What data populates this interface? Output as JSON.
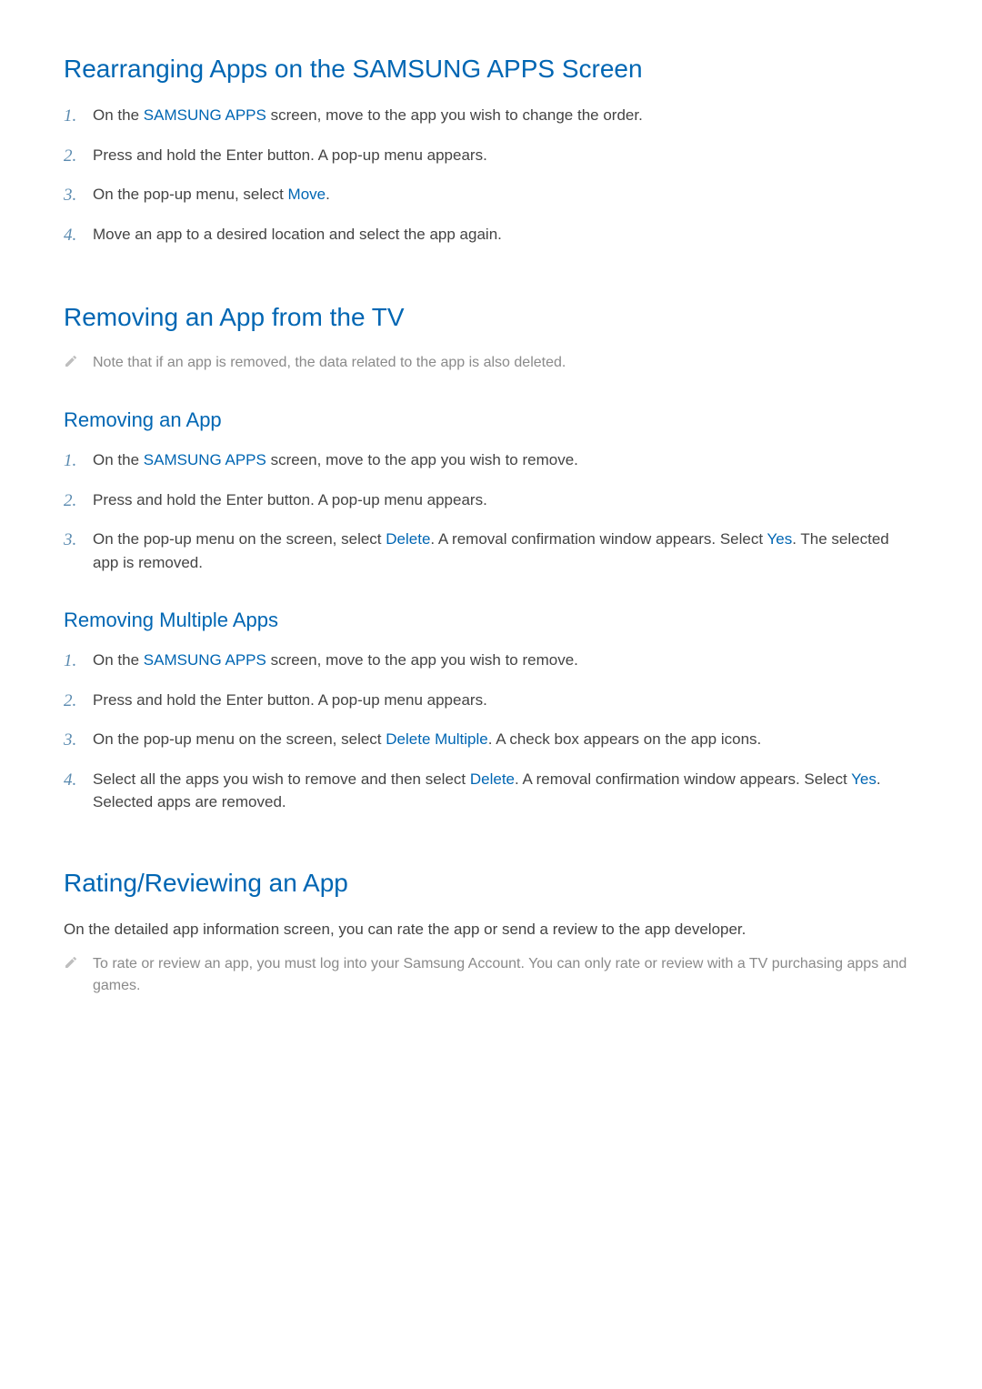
{
  "section1": {
    "heading": "Rearranging Apps on the SAMSUNG APPS Screen",
    "step1_a": "On the ",
    "step1_hl": "SAMSUNG APPS",
    "step1_b": " screen, move to the app you wish to change the order.",
    "step2": "Press and hold the Enter button. A pop-up menu appears.",
    "step3_a": "On the pop-up menu, select ",
    "step3_hl": "Move",
    "step3_b": ".",
    "step4": "Move an app to a desired location and select the app again."
  },
  "section2": {
    "heading": "Removing an App from the TV",
    "note": "Note that if an app is removed, the data related to the app is also deleted."
  },
  "section2a": {
    "heading": "Removing an App",
    "step1_a": "On the ",
    "step1_hl": "SAMSUNG APPS",
    "step1_b": " screen, move to the app you wish to remove.",
    "step2": "Press and hold the Enter button. A pop-up menu appears.",
    "step3_a": "On the pop-up menu on the screen, select ",
    "step3_hl1": "Delete",
    "step3_b": ". A removal confirmation window appears. Select ",
    "step3_hl2": "Yes",
    "step3_c": ". The selected app is removed."
  },
  "section2b": {
    "heading": "Removing Multiple Apps",
    "step1_a": "On the ",
    "step1_hl": "SAMSUNG APPS",
    "step1_b": " screen, move to the app you wish to remove.",
    "step2": "Press and hold the Enter button. A pop-up menu appears.",
    "step3_a": "On the pop-up menu on the screen, select ",
    "step3_hl": "Delete Multiple",
    "step3_b": ". A check box appears on the app icons.",
    "step4_a": "Select all the apps you wish to remove and then select ",
    "step4_hl1": "Delete",
    "step4_b": ". A removal confirmation window appears. Select ",
    "step4_hl2": "Yes",
    "step4_c": ". Selected apps are removed."
  },
  "section3": {
    "heading": "Rating/Reviewing an App",
    "para": "On the detailed app information screen, you can rate the app or send a review to the app developer.",
    "note": "To rate or review an app, you must log into your Samsung Account. You can only rate or review with a TV purchasing apps and games."
  },
  "nums": {
    "n1": "1.",
    "n2": "2.",
    "n3": "3.",
    "n4": "4."
  }
}
